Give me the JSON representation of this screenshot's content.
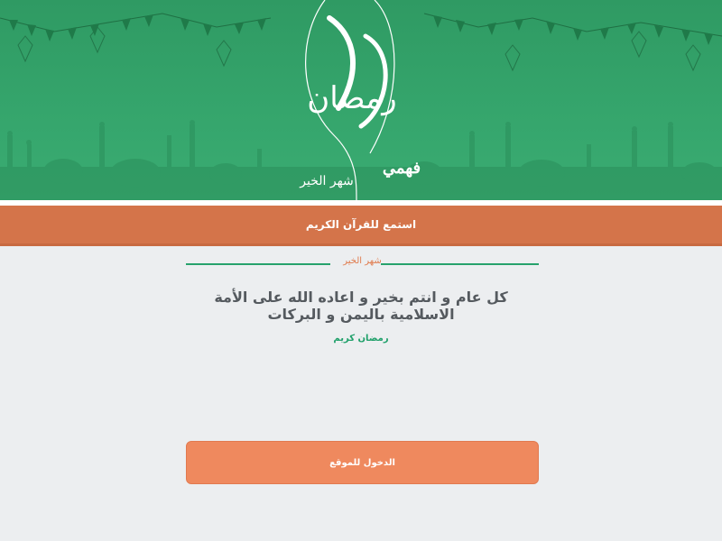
{
  "banner": {
    "logo_main": "رمضان",
    "logo_sub": "شهر الخير",
    "logo_brand": "فهمي",
    "theme_color": "#35a56c"
  },
  "nav": {
    "listen_label": "استمع للقرآن الكريم",
    "bar_color": "#d4744a"
  },
  "content": {
    "section_title": "شهر الخير",
    "greeting": "كل عام و انتم بخير و اعاده الله على الأمة الاسلامية باليمن و البركات",
    "subtitle": "رمضان كريم"
  },
  "actions": {
    "enter_label": "الدخول للموقع",
    "button_color": "#ef895e"
  }
}
